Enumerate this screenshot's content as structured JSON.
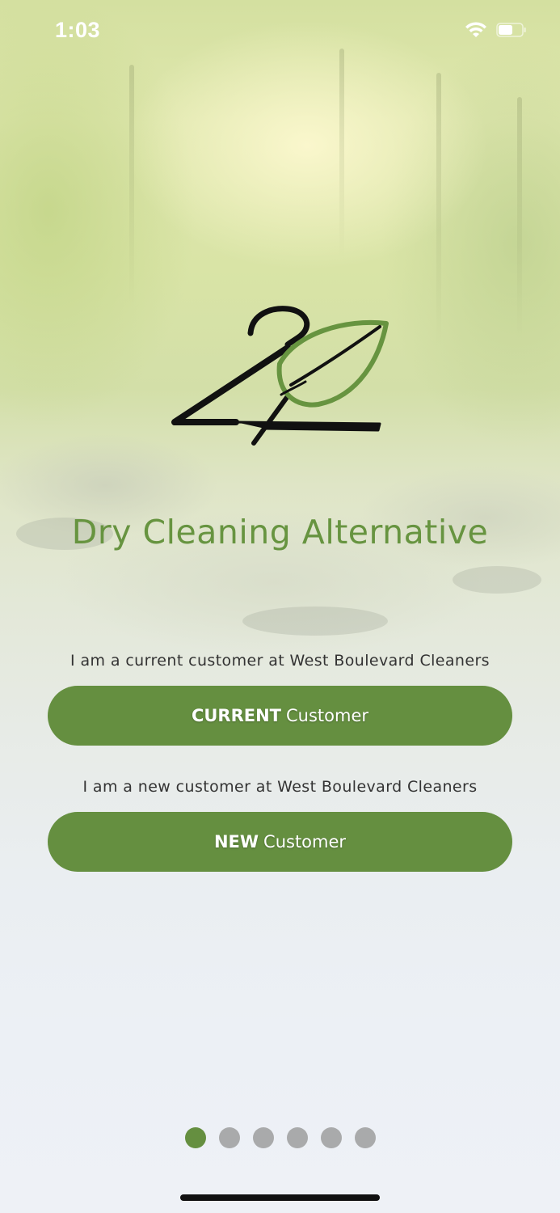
{
  "status_bar": {
    "time": "1:03",
    "wifi_icon": "wifi-icon",
    "battery_icon": "battery-icon"
  },
  "brand": {
    "logo_icon": "hanger-leaf-logo",
    "title": "Dry Cleaning Alternative",
    "accent_color": "#679440"
  },
  "current": {
    "prompt": "I am a current customer at West Boulevard Cleaners",
    "button_strong": "CURRENT",
    "button_rest": "Customer"
  },
  "new": {
    "prompt": "I am a new customer at West Boulevard Cleaners",
    "button_strong": "NEW",
    "button_rest": "Customer"
  },
  "pager": {
    "total_pages": 6,
    "active_page": 1,
    "active_color": "#658f40",
    "inactive_color": "#a9aaab"
  }
}
